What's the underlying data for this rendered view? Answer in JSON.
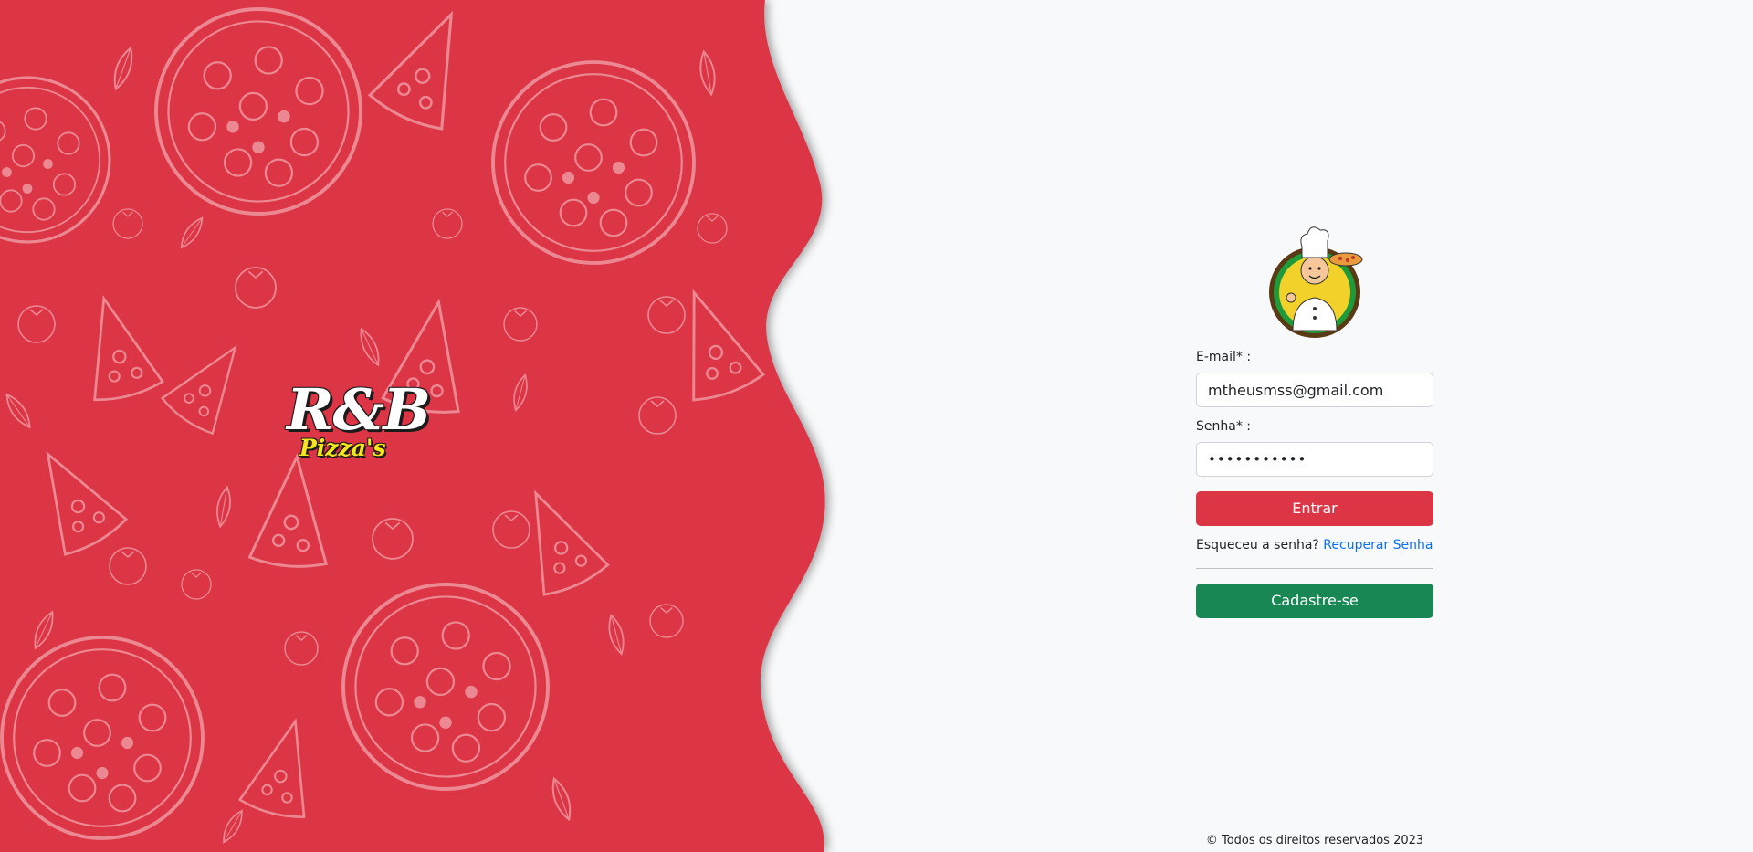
{
  "brand": {
    "main": "R&B",
    "sub": "Pizza's"
  },
  "colors": {
    "hero_red": "#dc3545",
    "primary": "#dc3545",
    "success": "#198754",
    "link": "#0d6efd",
    "background": "#f8f9fa"
  },
  "login": {
    "avatar_icon": "chef-mascot-icon",
    "email_label": "E-mail* :",
    "email_value": "mtheusmss@gmail.com",
    "password_label": "Senha* :",
    "password_value": "•••••••••••",
    "submit_label": "Entrar",
    "forgot_text": "Esqueceu a senha?",
    "recover_link": "Recuperar Senha",
    "register_label": "Cadastre-se"
  },
  "footer": {
    "copyright": "© Todos os direitos reservados 2023"
  }
}
